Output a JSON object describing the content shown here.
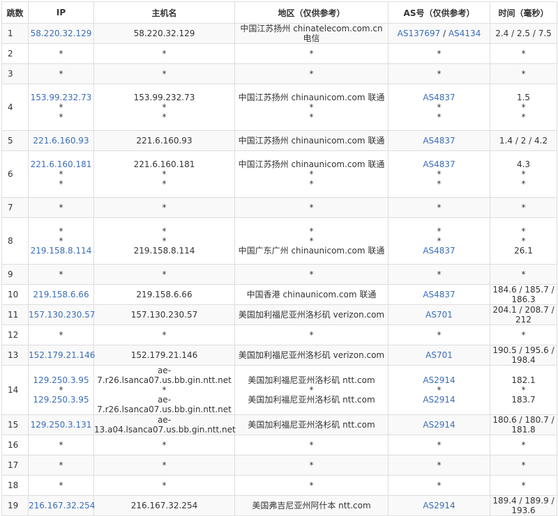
{
  "headers": {
    "hop": "跳数",
    "ip": "IP",
    "host": "主机名",
    "location": "地区（仅供参考）",
    "as": "AS号（仅供参考）",
    "time": "时间（毫秒）"
  },
  "colors": {
    "link": "#3a6db8",
    "text": "#333333",
    "border": "#dddddd",
    "stripe": "#f9f9f9"
  },
  "rows": [
    {
      "hop": "1",
      "lines": [
        {
          "ip": "58.220.32.129",
          "host": "58.220.32.129",
          "location": "中国江苏扬州 chinatelecom.com.cn 电信",
          "as": [
            "AS137697",
            "AS4134"
          ],
          "time": "2.4 / 2.5 / 7.5"
        }
      ]
    },
    {
      "hop": "2",
      "lines": [
        {
          "ip": "*",
          "host": "*",
          "location": "*",
          "as": [
            "*"
          ],
          "time": "*"
        }
      ]
    },
    {
      "hop": "3",
      "lines": [
        {
          "ip": "*",
          "host": "*",
          "location": "*",
          "as": [
            "*"
          ],
          "time": "*"
        }
      ]
    },
    {
      "hop": "4",
      "lines": [
        {
          "ip": "153.99.232.73",
          "host": "153.99.232.73",
          "location": "中国江苏扬州 chinaunicom.com 联通",
          "as": [
            "AS4837"
          ],
          "time": "1.5"
        },
        {
          "ip": "*",
          "host": "*",
          "location": "*",
          "as": [
            "*"
          ],
          "time": "*"
        },
        {
          "ip": "*",
          "host": "*",
          "location": "*",
          "as": [
            "*"
          ],
          "time": "*"
        }
      ]
    },
    {
      "hop": "5",
      "lines": [
        {
          "ip": "221.6.160.93",
          "host": "221.6.160.93",
          "location": "中国江苏扬州 chinaunicom.com 联通",
          "as": [
            "AS4837"
          ],
          "time": "1.4 / 2 / 4.2"
        }
      ]
    },
    {
      "hop": "6",
      "lines": [
        {
          "ip": "221.6.160.181",
          "host": "221.6.160.181",
          "location": "中国江苏扬州 chinaunicom.com 联通",
          "as": [
            "AS4837"
          ],
          "time": "4.3"
        },
        {
          "ip": "*",
          "host": "*",
          "location": "*",
          "as": [
            "*"
          ],
          "time": "*"
        },
        {
          "ip": "*",
          "host": "*",
          "location": "*",
          "as": [
            "*"
          ],
          "time": "*"
        }
      ]
    },
    {
      "hop": "7",
      "lines": [
        {
          "ip": "*",
          "host": "*",
          "location": "*",
          "as": [
            "*"
          ],
          "time": "*"
        }
      ]
    },
    {
      "hop": "8",
      "lines": [
        {
          "ip": "*",
          "host": "*",
          "location": "*",
          "as": [
            "*"
          ],
          "time": "*"
        },
        {
          "ip": "*",
          "host": "*",
          "location": "*",
          "as": [
            "*"
          ],
          "time": "*"
        },
        {
          "ip": "219.158.8.114",
          "host": "219.158.8.114",
          "location": "中国广东广州 chinaunicom.com 联通",
          "as": [
            "AS4837"
          ],
          "time": "26.1"
        }
      ]
    },
    {
      "hop": "9",
      "lines": [
        {
          "ip": "*",
          "host": "*",
          "location": "*",
          "as": [
            "*"
          ],
          "time": "*"
        }
      ]
    },
    {
      "hop": "10",
      "lines": [
        {
          "ip": "219.158.6.66",
          "host": "219.158.6.66",
          "location": "中国香港 chinaunicom.com 联通",
          "as": [
            "AS4837"
          ],
          "time": "184.6 / 185.7 / 186.3"
        }
      ]
    },
    {
      "hop": "11",
      "lines": [
        {
          "ip": "157.130.230.57",
          "host": "157.130.230.57",
          "location": "美国加利福尼亚州洛杉矶 verizon.com",
          "as": [
            "AS701"
          ],
          "time": "204.1 / 208.7 / 212"
        }
      ]
    },
    {
      "hop": "12",
      "lines": [
        {
          "ip": "*",
          "host": "*",
          "location": "*",
          "as": [
            "*"
          ],
          "time": "*"
        }
      ]
    },
    {
      "hop": "13",
      "lines": [
        {
          "ip": "152.179.21.146",
          "host": "152.179.21.146",
          "location": "美国加利福尼亚州洛杉矶 verizon.com",
          "as": [
            "AS701"
          ],
          "time": "190.5 / 195.6 / 198.4"
        }
      ]
    },
    {
      "hop": "14",
      "lines": [
        {
          "ip": "129.250.3.95",
          "host": "ae-7.r26.lsanca07.us.bb.gin.ntt.net",
          "location": "美国加利福尼亚州洛杉矶 ntt.com",
          "as": [
            "AS2914"
          ],
          "time": "182.1"
        },
        {
          "ip": "*",
          "host": "*",
          "location": "*",
          "as": [
            "*"
          ],
          "time": "*"
        },
        {
          "ip": "129.250.3.95",
          "host": "ae-7.r26.lsanca07.us.bb.gin.ntt.net",
          "location": "美国加利福尼亚州洛杉矶 ntt.com",
          "as": [
            "AS2914"
          ],
          "time": "183.7"
        }
      ]
    },
    {
      "hop": "15",
      "lines": [
        {
          "ip": "129.250.3.131",
          "host": "ae-13.a04.lsanca07.us.bb.gin.ntt.net",
          "location": "美国加利福尼亚州洛杉矶 ntt.com",
          "as": [
            "AS2914"
          ],
          "time": "180.6 / 180.7 / 181.8"
        }
      ]
    },
    {
      "hop": "16",
      "lines": [
        {
          "ip": "*",
          "host": "*",
          "location": "*",
          "as": [
            "*"
          ],
          "time": "*"
        }
      ]
    },
    {
      "hop": "17",
      "lines": [
        {
          "ip": "*",
          "host": "*",
          "location": "*",
          "as": [
            "*"
          ],
          "time": "*"
        }
      ]
    },
    {
      "hop": "18",
      "lines": [
        {
          "ip": "*",
          "host": "*",
          "location": "*",
          "as": [
            "*"
          ],
          "time": "*"
        }
      ]
    },
    {
      "hop": "19",
      "lines": [
        {
          "ip": "216.167.32.254",
          "host": "216.167.32.254",
          "location": "美国弗吉尼亚州阿什本 ntt.com",
          "as": [
            "AS2914"
          ],
          "time": "189.4 / 189.9 / 193.6"
        }
      ]
    }
  ]
}
